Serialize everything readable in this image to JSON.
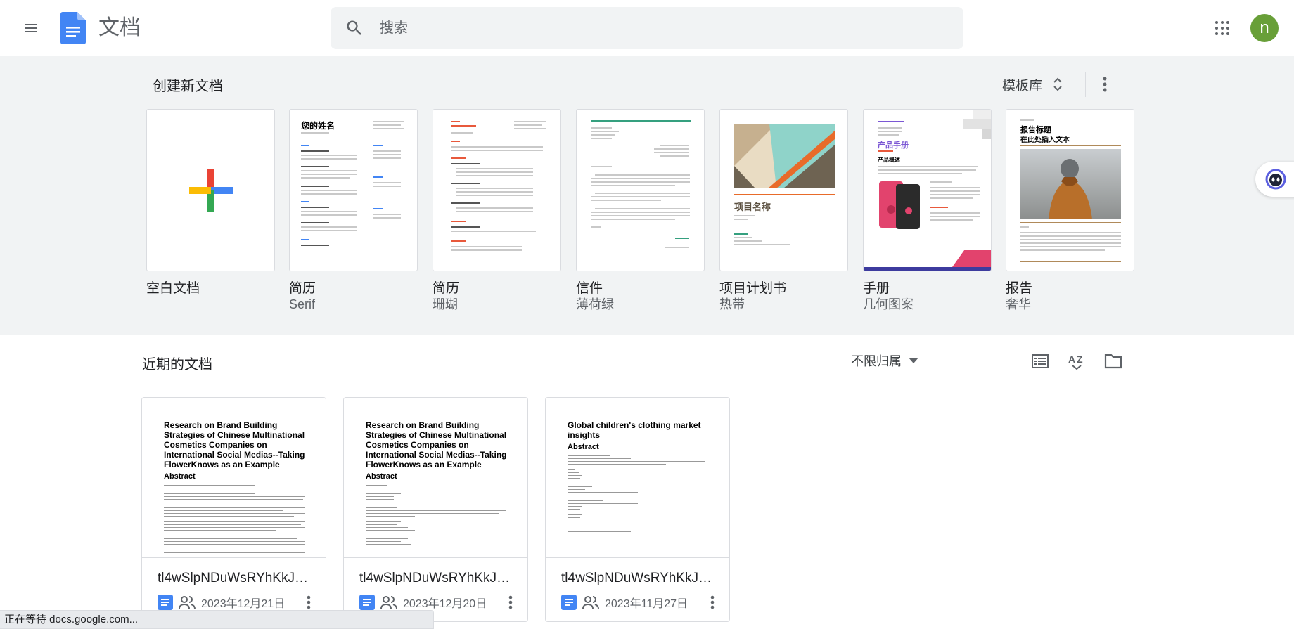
{
  "header": {
    "app_title": "文档",
    "search_placeholder": "搜索",
    "avatar_letter": "n"
  },
  "templates": {
    "section_title": "创建新文档",
    "gallery_label": "模板库",
    "items": [
      {
        "name": "空白文档",
        "sub": ""
      },
      {
        "name": "简历",
        "sub": "Serif",
        "thumb_title": "您的姓名"
      },
      {
        "name": "简历",
        "sub": "珊瑚"
      },
      {
        "name": "信件",
        "sub": "薄荷绿"
      },
      {
        "name": "项目计划书",
        "sub": "热带",
        "thumb_title": "项目名称"
      },
      {
        "name": "手册",
        "sub": "几何图案",
        "thumb_title": "产品手册",
        "thumb_sub": "产品概述"
      },
      {
        "name": "报告",
        "sub": "奢华",
        "thumb_title": "报告标题",
        "thumb_sub": "在此处插入文本"
      }
    ]
  },
  "recent": {
    "section_title": "近期的文档",
    "owner_filter": "不限归属",
    "docs": [
      {
        "name": "tl4wSlpNDuWsRYhKkJZt...",
        "date": "2023年12月21日",
        "thumb_title": "Research on Brand Building Strategies of Chinese Multinational Cosmetics Companies on International Social Medias--Taking FlowerKnows as an Example",
        "thumb_heading": "Abstract"
      },
      {
        "name": "tl4wSlpNDuWsRYhKkJZt...",
        "date": "2023年12月20日",
        "thumb_title": "Research on Brand Building Strategies of Chinese Multinational Cosmetics Companies on International Social Medias--Taking FlowerKnows as an Example",
        "thumb_heading": "Abstract"
      },
      {
        "name": "tl4wSlpNDuWsRYhKkJZt...",
        "date": "2023年11月27日",
        "thumb_title": "Global children's clothing market insights",
        "thumb_heading": "Abstract"
      }
    ]
  },
  "status_bar": "正在等待 docs.google.com...",
  "colors": {
    "docs_blue": "#4285f4",
    "avatar_green": "#689f38",
    "template_bg": "#f1f3f4"
  }
}
